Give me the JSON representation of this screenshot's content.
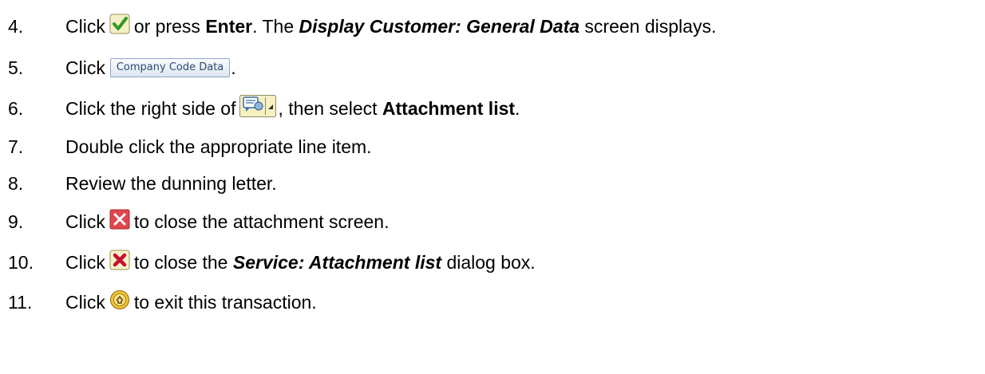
{
  "steps": [
    {
      "number": "4.",
      "parts": {
        "t1": "Click",
        "t2": "or press",
        "b1": "Enter",
        "t3": ". The",
        "bi1": "Display Customer: General Data",
        "t4": "screen displays."
      },
      "icon": "green-checkmark-icon"
    },
    {
      "number": "5.",
      "parts": {
        "t1": "Click",
        "button_label": "Company Code Data",
        "t2": "."
      }
    },
    {
      "number": "6.",
      "parts": {
        "t1": "Click the right side of",
        "t2": ", then select",
        "b1": "Attachment list",
        "t3": "."
      },
      "icon": "services-for-object-dropdown-icon"
    },
    {
      "number": "7.",
      "parts": {
        "t1": "Double click the appropriate line item."
      }
    },
    {
      "number": "8.",
      "parts": {
        "t1": "Review the dunning letter."
      }
    },
    {
      "number": "9.",
      "parts": {
        "t1": "Click",
        "t2": "to close the attachment screen."
      },
      "icon": "close-x-icon"
    },
    {
      "number": "10.",
      "parts": {
        "t1": "Click",
        "t2": "to close the",
        "bi1": "Service: Attachment list",
        "t3": "dialog box."
      },
      "icon": "cancel-icon"
    },
    {
      "number": "11.",
      "parts": {
        "t1": "Click",
        "t2": "to exit this transaction."
      },
      "icon": "exit-icon"
    }
  ],
  "colors": {
    "text": "#000000",
    "check_green": "#2f9a1e",
    "close_red": "#e0474c",
    "cancel_red": "#c8102e",
    "exit_yellow": "#f2c230"
  }
}
